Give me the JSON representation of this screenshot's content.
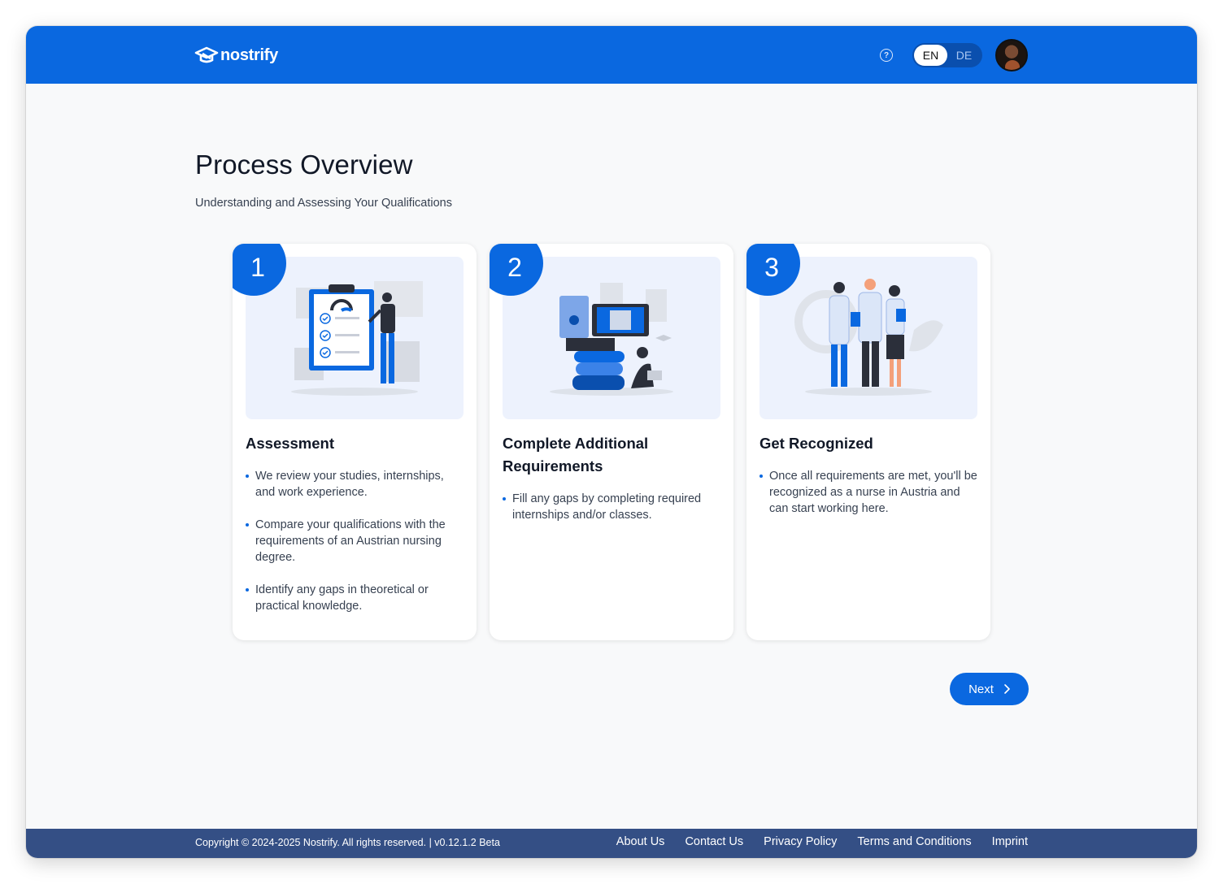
{
  "header": {
    "logo_text": "nostrify",
    "help_icon": "question-circle-icon",
    "languages": [
      {
        "code": "EN",
        "active": true
      },
      {
        "code": "DE",
        "active": false
      }
    ]
  },
  "main": {
    "title": "Process Overview",
    "subtitle": "Understanding and Assessing Your Qualifications",
    "cards": [
      {
        "step": "1",
        "illustration": "assessment-checklist-illustration",
        "title": "Assessment",
        "items": [
          "We review your studies, internships, and work experience.",
          "Compare your qualifications with the requirements of an Austrian nursing degree.",
          "Identify any gaps in theoretical or practical knowledge."
        ]
      },
      {
        "step": "2",
        "illustration": "books-and-student-illustration",
        "title": "Complete Additional Requirements",
        "items": [
          "Fill any gaps by completing required internships and/or classes."
        ]
      },
      {
        "step": "3",
        "illustration": "medical-staff-illustration",
        "title": "Get Recognized",
        "items": [
          "Once all requirements are met, you'll be recognized as a nurse in Austria and can start working here."
        ]
      }
    ],
    "next_label": "Next",
    "next_icon": "chevron-right-icon"
  },
  "footer": {
    "copyright": "Copyright © 2024-2025 Nostrify. All rights reserved. | v0.12.1.2 Beta",
    "links": [
      "About Us",
      "Contact Us",
      "Privacy Policy",
      "Terms and Conditions",
      "Imprint"
    ]
  },
  "colors": {
    "primary": "#0a68e0",
    "footer_bg": "#344f85",
    "illustration_bg": "#edf2fd"
  }
}
